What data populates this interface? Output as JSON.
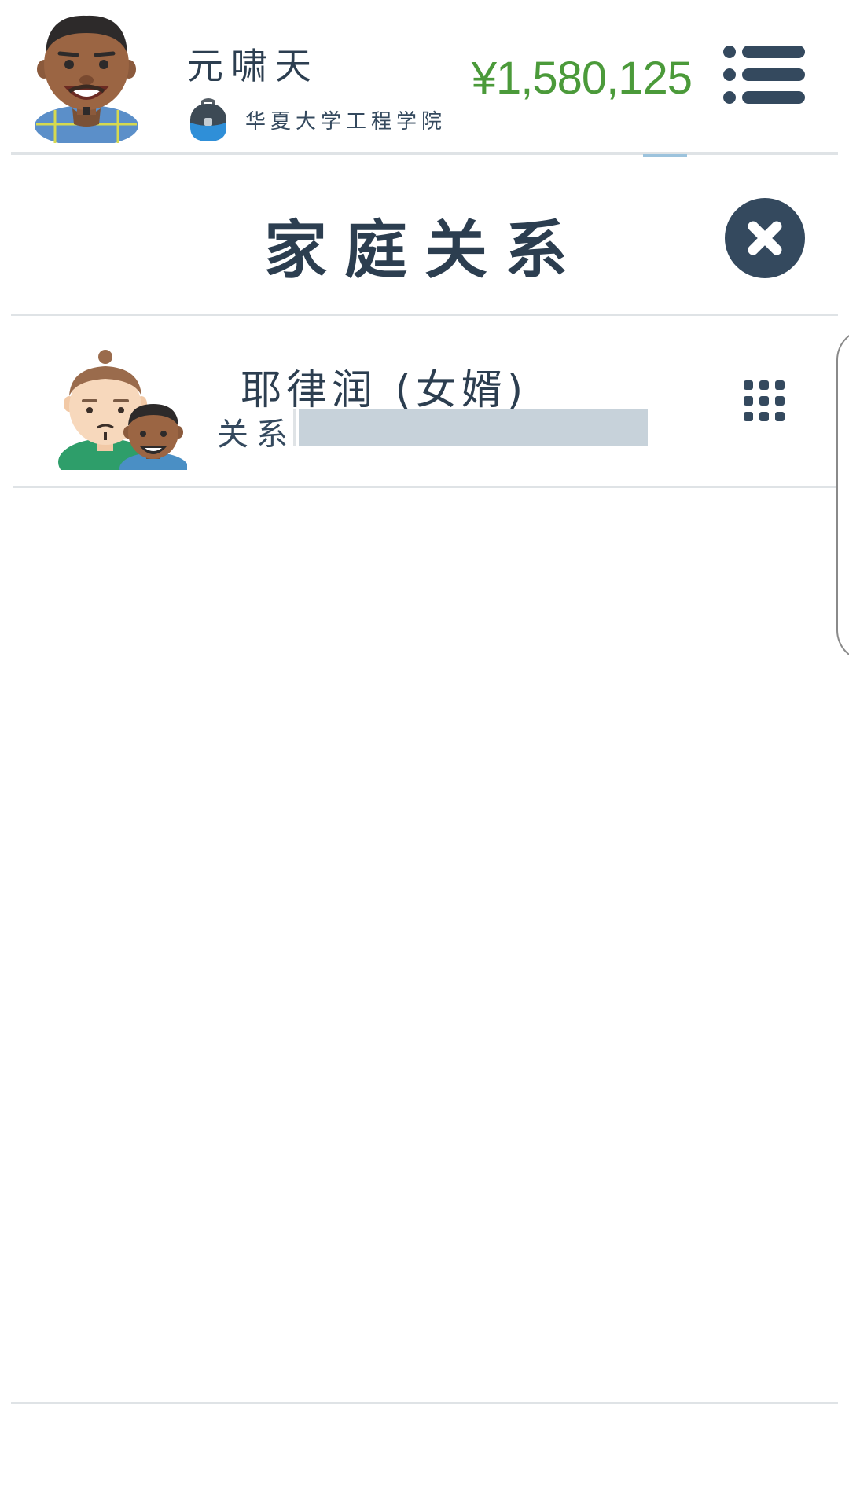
{
  "header": {
    "player_name": "元啸天",
    "school": "华夏大学工程学院",
    "money": "¥1,580,125",
    "avatar_icon": "man-avatar-icon",
    "school_icon": "backpack-icon",
    "menu_icon": "list-menu-icon"
  },
  "dialog": {
    "title": "家庭关系",
    "close_icon": "close-icon"
  },
  "relations": [
    {
      "name": "耶律润 (女婿)",
      "label": "关系",
      "level": 0,
      "avatar_icon": "two-men-avatar-icon",
      "action_icon": "grid-icon"
    }
  ],
  "colors": {
    "text": "#34495e",
    "money": "#4b9a3a",
    "bar_track": "#c7d2da",
    "close_bg": "#34495e",
    "divider": "#dfe3e6"
  }
}
